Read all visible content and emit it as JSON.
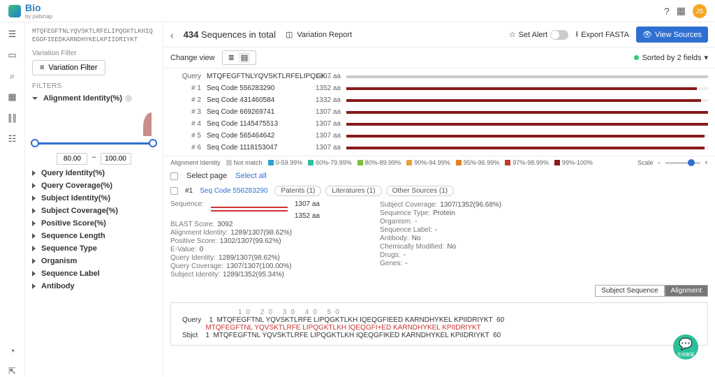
{
  "brand": {
    "name": "Bio",
    "byline": "by patsnap",
    "avatar_initials": "JS"
  },
  "sidebar": {
    "sequence": "MTQFEGFTNLYQVSKTLRFELIPQGKTLKHIQEGOFIEEDKARNDHYKELKPIIDRIYKT",
    "variation_filter_label": "Variation Filter",
    "variation_filter_button": "Variation Filter",
    "filters_heading": "FILTERS",
    "open_group": "Alignment Identity(%)",
    "range": {
      "min": "80.00",
      "max": "100.00"
    },
    "groups": [
      "Query Identity(%)",
      "Query Coverage(%)",
      "Subject Identity(%)",
      "Subject Coverage(%)",
      "Positive Score(%)",
      "Sequence Length",
      "Sequence Type",
      "Organism",
      "Sequence Label",
      "Antibody"
    ]
  },
  "header": {
    "count": "434",
    "title": "Sequences in total",
    "variation_report": "Variation Report",
    "set_alert": "Set Alert",
    "export_fasta": "Export FASTA",
    "view_sources": "View Sources",
    "change_view": "Change view",
    "sort": "Sorted by 2 fields"
  },
  "rows": [
    {
      "label": "Query",
      "code": "MTQFEGFTNLYQVSKTLRFELIPQGK...",
      "aa": "1307 aa",
      "pct": 0
    },
    {
      "label": "# 1",
      "code": "Seq Code 556283290",
      "aa": "1352 aa",
      "pct": 97
    },
    {
      "label": "# 2",
      "code": "Seq Code 431460584",
      "aa": "1332 aa",
      "pct": 98
    },
    {
      "label": "# 3",
      "code": "Seq Code 669269741",
      "aa": "1307 aa",
      "pct": 100
    },
    {
      "label": "# 4",
      "code": "Seq Code 1145475513",
      "aa": "1307 aa",
      "pct": 100
    },
    {
      "label": "# 5",
      "code": "Seq Code 565464642",
      "aa": "1307 aa",
      "pct": 99
    },
    {
      "label": "# 6",
      "code": "Seq Code 1118153047",
      "aa": "1307 aa",
      "pct": 99
    }
  ],
  "legend": {
    "title": "Alignment Identity",
    "items": [
      {
        "label": "Not match",
        "color": "#ccc"
      },
      {
        "label": "0-59.99%",
        "color": "#2f9fd1"
      },
      {
        "label": "60%-79.99%",
        "color": "#2fbf9a"
      },
      {
        "label": "80%-89.99%",
        "color": "#7fbf3f"
      },
      {
        "label": "90%-94.99%",
        "color": "#e6a23c"
      },
      {
        "label": "95%-96.99%",
        "color": "#e67e22"
      },
      {
        "label": "97%-98.99%",
        "color": "#c0392b"
      },
      {
        "label": "99%-100%",
        "color": "#8b1a1a"
      }
    ],
    "scale": "Scale"
  },
  "select": {
    "page": "Select page",
    "all": "Select all"
  },
  "record": {
    "index": "#1",
    "link": "Seq Code 556283290",
    "pills": [
      "Patents (1)",
      "Literatures (1)",
      "Other Sources (1)"
    ],
    "seq_label": "Sequence:",
    "aa1": "1307 aa",
    "aa2": "1352 aa",
    "left": [
      {
        "k": "BLAST Score:",
        "v": "3092"
      },
      {
        "k": "Alignment Identity:",
        "v": "1289/1307(98.62%)"
      },
      {
        "k": "Positive Score:",
        "v": "1302/1307(99.62%)"
      },
      {
        "k": "E-Value:",
        "v": "0"
      },
      {
        "k": "Query Identity:",
        "v": "1289/1307(98.62%)"
      },
      {
        "k": "Query Coverage:",
        "v": "1307/1307(100.00%)"
      },
      {
        "k": "Subject Identity:",
        "v": "1289/1352(95.34%)"
      }
    ],
    "right": [
      {
        "k": "Subject Coverage:",
        "v": "1307/1352(96.68%)"
      },
      {
        "k": "Sequence Type:",
        "v": "Protein"
      },
      {
        "k": "Organism:",
        "v": "-"
      },
      {
        "k": "Sequence Label:",
        "v": "-"
      },
      {
        "k": "Antibody:",
        "v": "No"
      },
      {
        "k": "Chemically Modified:",
        "v": "No"
      },
      {
        "k": "Drugs:",
        "v": "-"
      },
      {
        "k": "Genes:",
        "v": "-"
      }
    ],
    "tabs": {
      "subject": "Subject Sequence",
      "alignment": "Alignment"
    },
    "ruler": "10      20      30      40      50",
    "align": [
      {
        "name": "Query",
        "s": "1",
        "seq": "MTQFEGFTNL YQVSKTLRFE LIPQGKTLKH IQEQGFIEED KARNDHYKEL KPIIDRIYKT",
        "e": "60",
        "cls": ""
      },
      {
        "name": "",
        "s": "",
        "seq": "MTQFEGFTNL YQVSKTLRFE LIPQGKTLKH IQEQGFI+ED KARNDHYKEL KPIIDRIYKT",
        "e": "",
        "cls": "match"
      },
      {
        "name": "Sbjct",
        "s": "1",
        "seq": "MTQFEGFTNL YQVSKTLRFE LIPQGKTLKH IQEQGFIKED KARNDHYKEL KPIIDRIYKT",
        "e": "60",
        "cls": ""
      }
    ]
  },
  "fab": "在线客服"
}
